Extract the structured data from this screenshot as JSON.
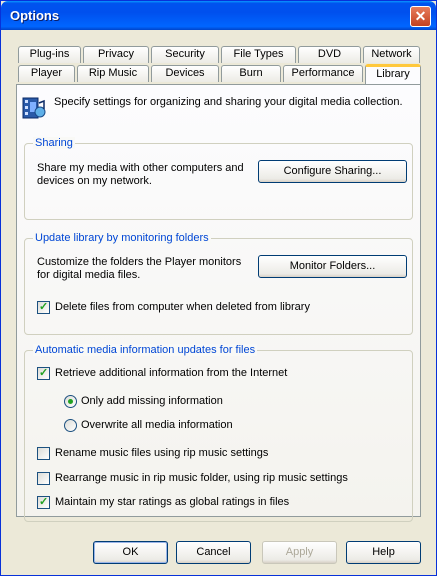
{
  "window": {
    "title": "Options",
    "close_label": "✕"
  },
  "tabs": {
    "back_row": [
      "Plug-ins",
      "Privacy",
      "Security",
      "File Types",
      "DVD",
      "Network"
    ],
    "front_row": [
      "Player",
      "Rip Music",
      "Devices",
      "Burn",
      "Performance",
      "Library"
    ],
    "active": "Library"
  },
  "description": "Specify settings for organizing and sharing your digital media collection.",
  "sharing": {
    "legend": "Sharing",
    "text": "Share my media with other computers and devices on my network.",
    "button": "Configure Sharing..."
  },
  "monitoring": {
    "legend": "Update library by monitoring folders",
    "text": "Customize the folders the Player monitors for digital media files.",
    "button": "Monitor Folders...",
    "delete_checkbox": {
      "label": "Delete files from computer when deleted from library",
      "checked": true
    }
  },
  "auto_updates": {
    "legend": "Automatic media information updates for files",
    "retrieve": {
      "label": "Retrieve additional information from the Internet",
      "checked": true
    },
    "radio_missing": {
      "label": "Only add missing information",
      "selected": true
    },
    "radio_overwrite": {
      "label": "Overwrite all media information",
      "selected": false
    },
    "rename": {
      "label": "Rename music files using rip music settings",
      "checked": false
    },
    "rearrange": {
      "label": "Rearrange music in rip music folder, using rip music settings",
      "checked": false
    },
    "ratings": {
      "label": "Maintain my star ratings as global ratings in files",
      "checked": true
    }
  },
  "footer": {
    "ok": "OK",
    "cancel": "Cancel",
    "apply": "Apply",
    "help": "Help"
  }
}
